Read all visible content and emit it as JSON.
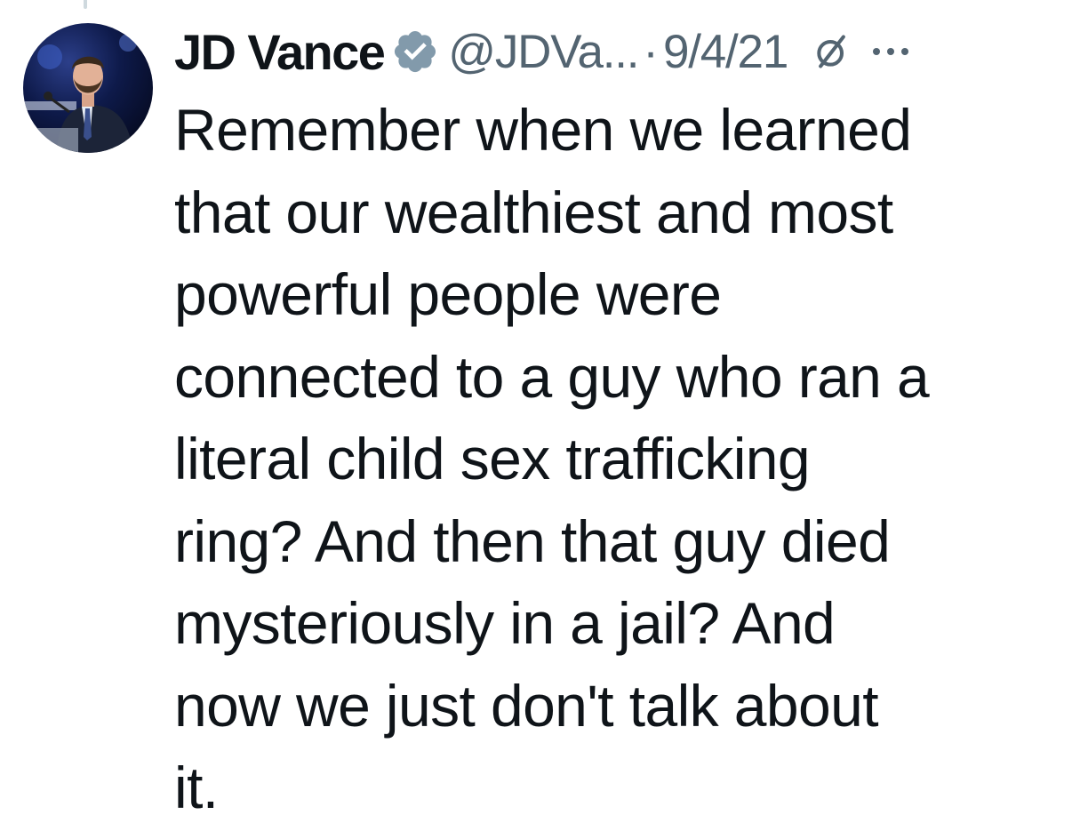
{
  "tweet": {
    "author": {
      "display_name": "JD Vance",
      "handle": "@JDVa...",
      "verified": true,
      "verified_badge_color": "#829aab"
    },
    "separator": "·",
    "date": "9/4/21",
    "edited_icon": "edit-history-icon",
    "more_icon": "more-options-icon",
    "text_lines": [
      "Remember when we learned",
      "that our wealthiest and most",
      "powerful people were",
      "connected to a guy who ran a",
      "literal child sex trafficking",
      "ring? And then that guy died",
      "mysteriously in a jail? And",
      "now we just don't talk about",
      "it."
    ]
  },
  "colors": {
    "text_primary": "#0f1419",
    "text_secondary": "#536471",
    "background": "#ffffff"
  }
}
